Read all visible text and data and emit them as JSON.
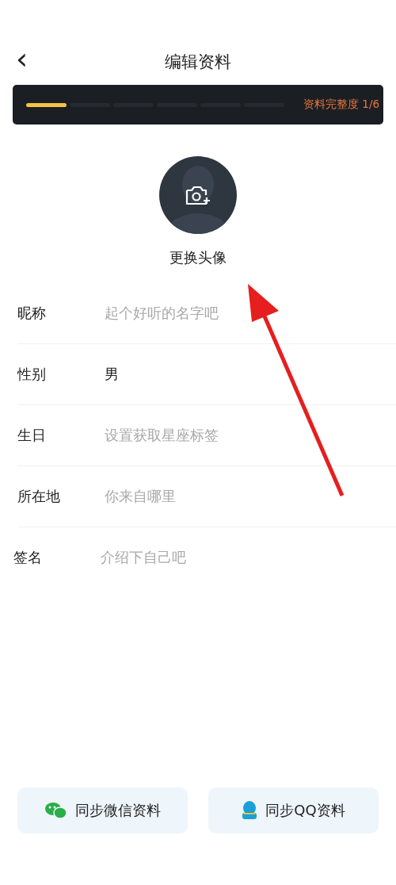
{
  "header": {
    "back_icon": "‹",
    "title": "编辑资料"
  },
  "progress": {
    "label": "资料完整度 1/6",
    "segments": [
      {
        "filled": true
      },
      {
        "filled": false
      },
      {
        "filled": false
      },
      {
        "filled": false
      },
      {
        "filled": false
      },
      {
        "filled": false
      }
    ]
  },
  "avatar": {
    "label": "更换头像"
  },
  "fields": [
    {
      "label": "昵称",
      "placeholder": "起个好听的名字吧"
    },
    {
      "label": "性别",
      "value": "男"
    },
    {
      "label": "生日",
      "placeholder": "设置获取星座标签"
    },
    {
      "label": "所在地",
      "placeholder": "你来自哪里"
    },
    {
      "label": "签名",
      "placeholder": "介绍下自己吧"
    }
  ],
  "sync_buttons": [
    {
      "kind": "wechat",
      "label": "同步微信资料"
    },
    {
      "kind": "qq",
      "label": "同步QQ资料"
    }
  ]
}
